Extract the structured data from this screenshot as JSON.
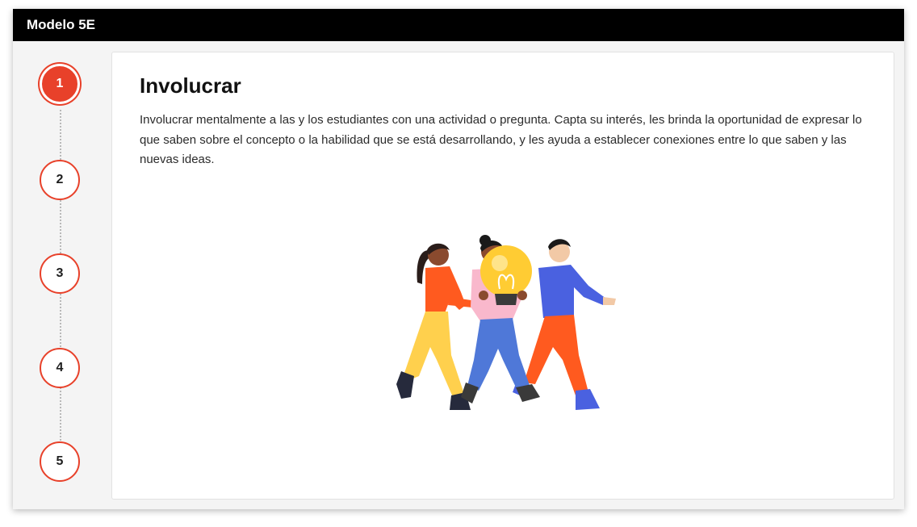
{
  "window": {
    "title": "Modelo 5E"
  },
  "steps": [
    {
      "label": "1",
      "active": true
    },
    {
      "label": "2",
      "active": false
    },
    {
      "label": "3",
      "active": false
    },
    {
      "label": "4",
      "active": false
    },
    {
      "label": "5",
      "active": false
    }
  ],
  "content": {
    "heading": "Involucrar",
    "body": "Involucrar mentalmente a las y los estudiantes con una actividad o pregunta. Capta su interés, les brinda la oportunidad de expresar lo que saben sobre el concepto o la habilidad que se está desarrollando, y les ayuda a establecer conexiones entre lo que saben y las nuevas ideas.",
    "illustration_icon": "people-carrying-lightbulb-illustration"
  },
  "colors": {
    "accent": "#e8412a",
    "titlebar": "#000000"
  }
}
